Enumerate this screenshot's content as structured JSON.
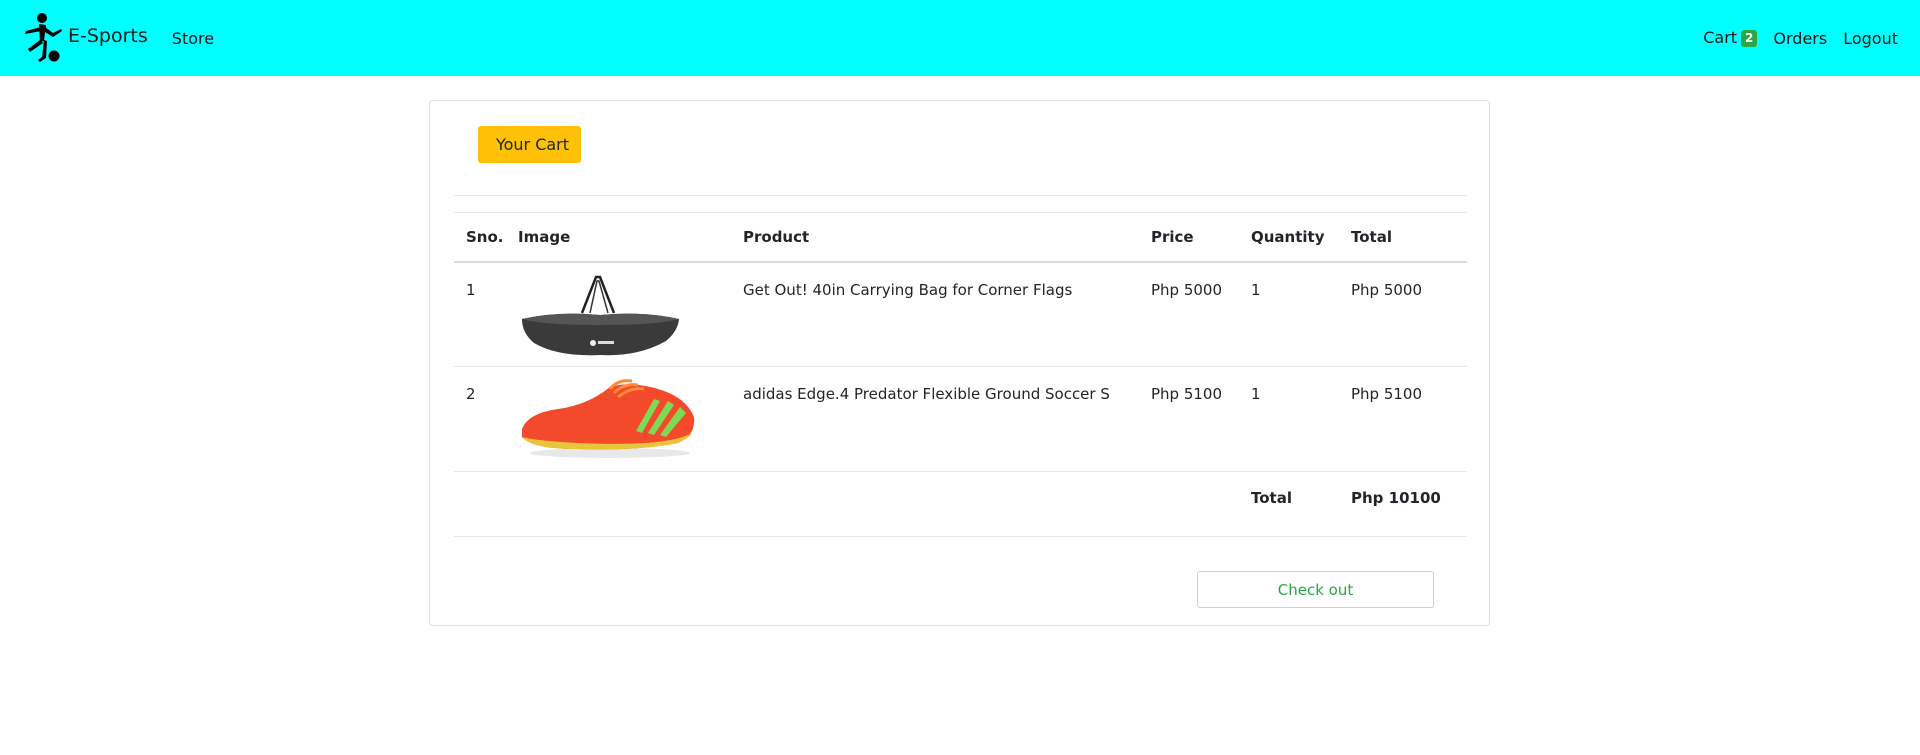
{
  "nav": {
    "brand": "E-Sports",
    "store": "Store",
    "cart": "Cart",
    "cart_count": "2",
    "orders": "Orders",
    "logout": "Logout"
  },
  "cart": {
    "title": "Your Cart",
    "headers": [
      "Sno.",
      "Image",
      "Product",
      "Price",
      "Quantity",
      "Total"
    ],
    "items": [
      {
        "sno": "1",
        "image": "bag-image",
        "product": "Get Out! 40in Carrying Bag for Corner Flags",
        "price": "Php 5000",
        "quantity": "1",
        "total": "Php 5000"
      },
      {
        "sno": "2",
        "image": "soccer-shoe-image",
        "product": "adidas Edge.4 Predator Flexible Ground Soccer S",
        "price": "Php 5100",
        "quantity": "1",
        "total": "Php 5100"
      }
    ],
    "total_label": "Total",
    "total_value": "Php 10100",
    "checkout": "Check out"
  },
  "colors": {
    "navbar": "#00ffff",
    "cart_button": "#ffc107",
    "badge": "#28a745",
    "checkout_text": "#28a745"
  }
}
